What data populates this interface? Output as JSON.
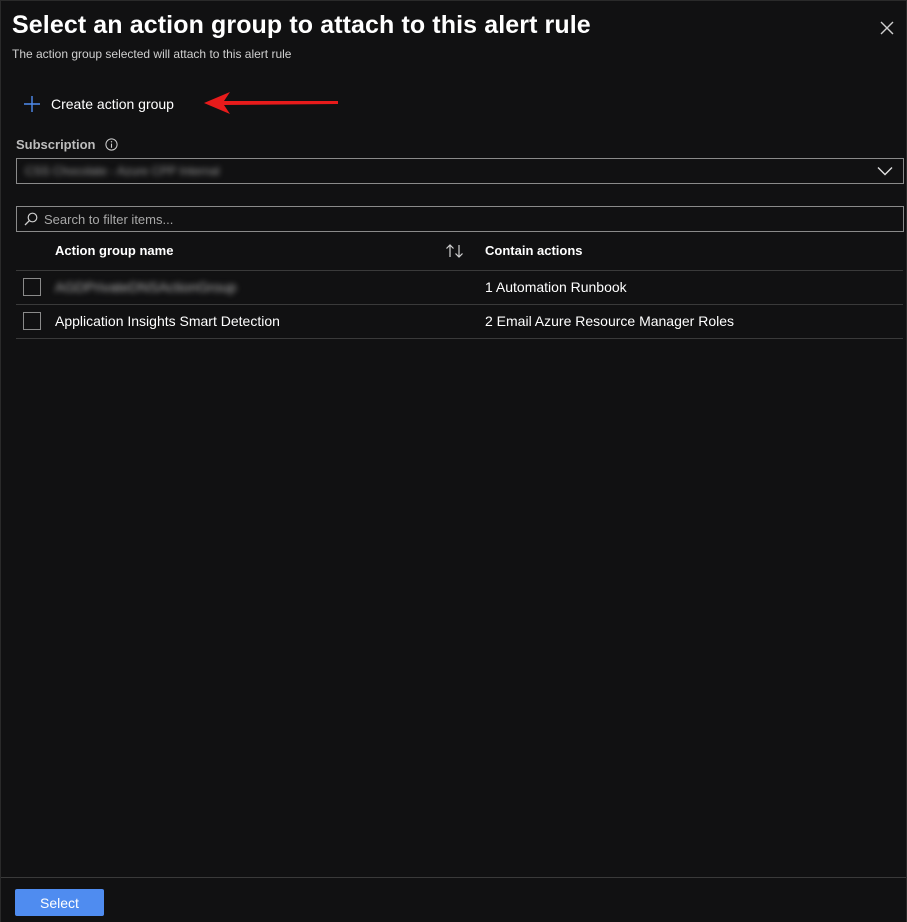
{
  "header": {
    "title": "Select an action group to attach to this alert rule",
    "subtitle": "The action group selected will attach to this alert rule"
  },
  "toolbar": {
    "create_label": "Create action group"
  },
  "subscription": {
    "label": "Subscription",
    "value": "CSS Chocolate - Azure CPP Internal"
  },
  "search": {
    "placeholder": "Search to filter items..."
  },
  "table": {
    "columns": [
      "Action group name",
      "Contain actions"
    ],
    "rows": [
      {
        "name": "AGDPrivateDNSActionGroup",
        "actions": "1 Automation Runbook"
      },
      {
        "name": "Application Insights Smart Detection",
        "actions": "2 Email Azure Resource Manager Roles"
      }
    ]
  },
  "footer": {
    "select_label": "Select"
  },
  "colors": {
    "background": "#111112",
    "accent": "#4f8cf0",
    "annotation_arrow": "#e81b1b"
  }
}
